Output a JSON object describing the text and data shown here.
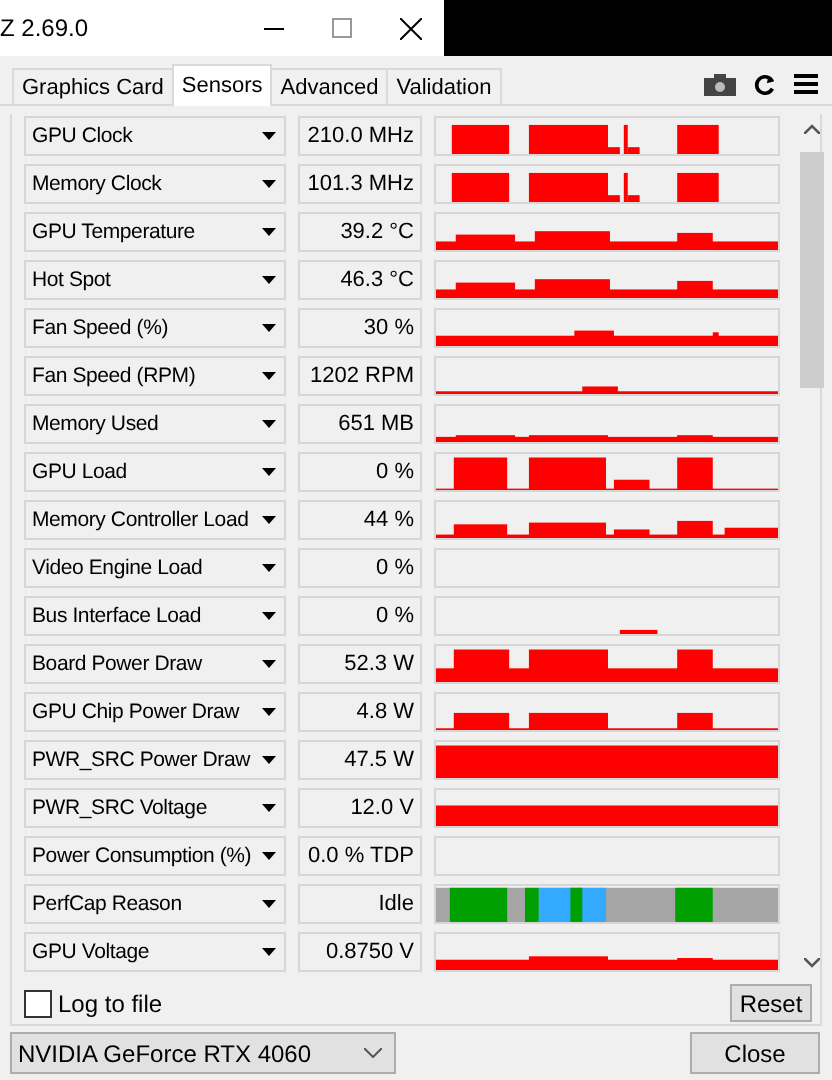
{
  "window": {
    "title": "Z 2.69.0"
  },
  "tabs": [
    {
      "label": "Graphics Card",
      "selected": false
    },
    {
      "label": "Sensors",
      "selected": true
    },
    {
      "label": "Advanced",
      "selected": false
    },
    {
      "label": "Validation",
      "selected": false
    }
  ],
  "sensors": [
    {
      "name": "GPU Clock",
      "value": "210.0 MHz",
      "kind": "clock"
    },
    {
      "name": "Memory Clock",
      "value": "101.3 MHz",
      "kind": "clock"
    },
    {
      "name": "GPU Temperature",
      "value": "39.2 °C",
      "kind": "temp"
    },
    {
      "name": "Hot Spot",
      "value": "46.3 °C",
      "kind": "temp"
    },
    {
      "name": "Fan Speed (%)",
      "value": "30 %",
      "kind": "fan"
    },
    {
      "name": "Fan Speed (RPM)",
      "value": "1202 RPM",
      "kind": "rpm"
    },
    {
      "name": "Memory Used",
      "value": "651 MB",
      "kind": "mem"
    },
    {
      "name": "GPU Load",
      "value": "0 %",
      "kind": "load"
    },
    {
      "name": "Memory Controller Load",
      "value": "44 %",
      "kind": "mcload"
    },
    {
      "name": "Video Engine Load",
      "value": "0 %",
      "kind": "empty"
    },
    {
      "name": "Bus Interface Load",
      "value": "0 %",
      "kind": "bus"
    },
    {
      "name": "Board Power Draw",
      "value": "52.3 W",
      "kind": "power"
    },
    {
      "name": "GPU Chip Power Draw",
      "value": "4.8 W",
      "kind": "chip"
    },
    {
      "name": "PWR_SRC Power Draw",
      "value": "47.5 W",
      "kind": "full"
    },
    {
      "name": "PWR_SRC Voltage",
      "value": "12.0 V",
      "kind": "volt"
    },
    {
      "name": "Power Consumption (%)",
      "value": "0.0 % TDP",
      "kind": "empty"
    },
    {
      "name": "PerfCap Reason",
      "value": "Idle",
      "kind": "perfcap"
    },
    {
      "name": "GPU Voltage",
      "value": "0.8750 V",
      "kind": "gpuvolt"
    }
  ],
  "log_to_file": {
    "label": "Log to file",
    "checked": false
  },
  "reset_button": "Reset",
  "gpu_select": "NVIDIA GeForce RTX 4060",
  "close_button": "Close"
}
